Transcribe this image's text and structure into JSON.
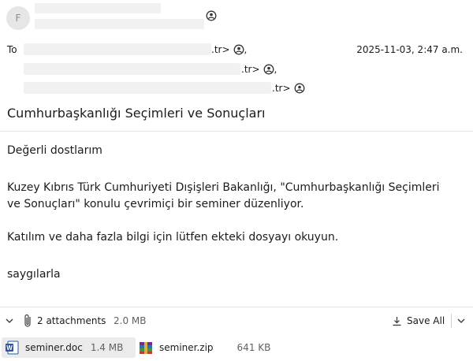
{
  "sender": {
    "avatar_initial": "F"
  },
  "recipients": {
    "to_label": "To",
    "lines": [
      ".tr>",
      ".tr>",
      ".tr>"
    ],
    "separators": [
      ",",
      ","
    ]
  },
  "timestamp": "2025-11-03, 2:47 a.m.",
  "subject": "Cumhurbaşkanlığı Seçimleri ve Sonuçları",
  "body": {
    "greeting": "Değerli dostlarım",
    "paragraph1_line1": "Kuzey Kıbrıs Türk Cumhuriyeti Dışişleri Bakanlığı, \"Cumhurbaşkanlığı Seçimleri",
    "paragraph1_line2": "ve Sonuçları\" konulu çevrimiçi bir seminer düzenliyor.",
    "paragraph2": "Katılım ve daha fazla bilgi için lütfen ekteki dosyayı okuyun.",
    "closing": "saygılarla"
  },
  "attachments": {
    "summary_label": "2 attachments",
    "total_size": "2.0 MB",
    "save_all_label": "Save All",
    "files": [
      {
        "name": "seminer.doc",
        "size": "1.4 MB",
        "icon": "word-doc-icon"
      },
      {
        "name": "seminer.zip",
        "size": "641 KB",
        "icon": "zip-archive-icon"
      }
    ]
  },
  "colors": {
    "word_blue": "#2b579a",
    "selected_chip": "#ebebeb"
  }
}
